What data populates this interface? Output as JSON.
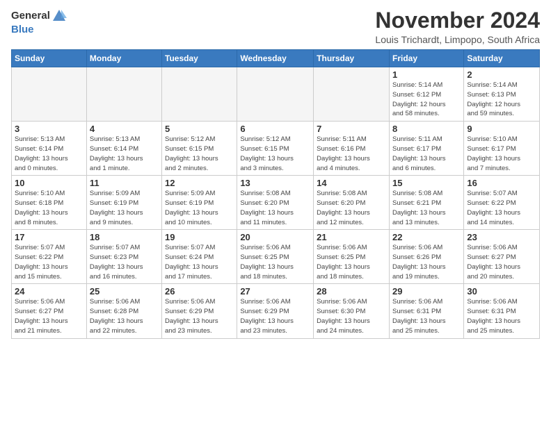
{
  "header": {
    "logo_general": "General",
    "logo_blue": "Blue",
    "title": "November 2024",
    "subtitle": "Louis Trichardt, Limpopo, South Africa"
  },
  "weekdays": [
    "Sunday",
    "Monday",
    "Tuesday",
    "Wednesday",
    "Thursday",
    "Friday",
    "Saturday"
  ],
  "weeks": [
    [
      {
        "day": "",
        "info": ""
      },
      {
        "day": "",
        "info": ""
      },
      {
        "day": "",
        "info": ""
      },
      {
        "day": "",
        "info": ""
      },
      {
        "day": "",
        "info": ""
      },
      {
        "day": "1",
        "info": "Sunrise: 5:14 AM\nSunset: 6:12 PM\nDaylight: 12 hours\nand 58 minutes."
      },
      {
        "day": "2",
        "info": "Sunrise: 5:14 AM\nSunset: 6:13 PM\nDaylight: 12 hours\nand 59 minutes."
      }
    ],
    [
      {
        "day": "3",
        "info": "Sunrise: 5:13 AM\nSunset: 6:14 PM\nDaylight: 13 hours\nand 0 minutes."
      },
      {
        "day": "4",
        "info": "Sunrise: 5:13 AM\nSunset: 6:14 PM\nDaylight: 13 hours\nand 1 minute."
      },
      {
        "day": "5",
        "info": "Sunrise: 5:12 AM\nSunset: 6:15 PM\nDaylight: 13 hours\nand 2 minutes."
      },
      {
        "day": "6",
        "info": "Sunrise: 5:12 AM\nSunset: 6:15 PM\nDaylight: 13 hours\nand 3 minutes."
      },
      {
        "day": "7",
        "info": "Sunrise: 5:11 AM\nSunset: 6:16 PM\nDaylight: 13 hours\nand 4 minutes."
      },
      {
        "day": "8",
        "info": "Sunrise: 5:11 AM\nSunset: 6:17 PM\nDaylight: 13 hours\nand 6 minutes."
      },
      {
        "day": "9",
        "info": "Sunrise: 5:10 AM\nSunset: 6:17 PM\nDaylight: 13 hours\nand 7 minutes."
      }
    ],
    [
      {
        "day": "10",
        "info": "Sunrise: 5:10 AM\nSunset: 6:18 PM\nDaylight: 13 hours\nand 8 minutes."
      },
      {
        "day": "11",
        "info": "Sunrise: 5:09 AM\nSunset: 6:19 PM\nDaylight: 13 hours\nand 9 minutes."
      },
      {
        "day": "12",
        "info": "Sunrise: 5:09 AM\nSunset: 6:19 PM\nDaylight: 13 hours\nand 10 minutes."
      },
      {
        "day": "13",
        "info": "Sunrise: 5:08 AM\nSunset: 6:20 PM\nDaylight: 13 hours\nand 11 minutes."
      },
      {
        "day": "14",
        "info": "Sunrise: 5:08 AM\nSunset: 6:20 PM\nDaylight: 13 hours\nand 12 minutes."
      },
      {
        "day": "15",
        "info": "Sunrise: 5:08 AM\nSunset: 6:21 PM\nDaylight: 13 hours\nand 13 minutes."
      },
      {
        "day": "16",
        "info": "Sunrise: 5:07 AM\nSunset: 6:22 PM\nDaylight: 13 hours\nand 14 minutes."
      }
    ],
    [
      {
        "day": "17",
        "info": "Sunrise: 5:07 AM\nSunset: 6:22 PM\nDaylight: 13 hours\nand 15 minutes."
      },
      {
        "day": "18",
        "info": "Sunrise: 5:07 AM\nSunset: 6:23 PM\nDaylight: 13 hours\nand 16 minutes."
      },
      {
        "day": "19",
        "info": "Sunrise: 5:07 AM\nSunset: 6:24 PM\nDaylight: 13 hours\nand 17 minutes."
      },
      {
        "day": "20",
        "info": "Sunrise: 5:06 AM\nSunset: 6:25 PM\nDaylight: 13 hours\nand 18 minutes."
      },
      {
        "day": "21",
        "info": "Sunrise: 5:06 AM\nSunset: 6:25 PM\nDaylight: 13 hours\nand 18 minutes."
      },
      {
        "day": "22",
        "info": "Sunrise: 5:06 AM\nSunset: 6:26 PM\nDaylight: 13 hours\nand 19 minutes."
      },
      {
        "day": "23",
        "info": "Sunrise: 5:06 AM\nSunset: 6:27 PM\nDaylight: 13 hours\nand 20 minutes."
      }
    ],
    [
      {
        "day": "24",
        "info": "Sunrise: 5:06 AM\nSunset: 6:27 PM\nDaylight: 13 hours\nand 21 minutes."
      },
      {
        "day": "25",
        "info": "Sunrise: 5:06 AM\nSunset: 6:28 PM\nDaylight: 13 hours\nand 22 minutes."
      },
      {
        "day": "26",
        "info": "Sunrise: 5:06 AM\nSunset: 6:29 PM\nDaylight: 13 hours\nand 23 minutes."
      },
      {
        "day": "27",
        "info": "Sunrise: 5:06 AM\nSunset: 6:29 PM\nDaylight: 13 hours\nand 23 minutes."
      },
      {
        "day": "28",
        "info": "Sunrise: 5:06 AM\nSunset: 6:30 PM\nDaylight: 13 hours\nand 24 minutes."
      },
      {
        "day": "29",
        "info": "Sunrise: 5:06 AM\nSunset: 6:31 PM\nDaylight: 13 hours\nand 25 minutes."
      },
      {
        "day": "30",
        "info": "Sunrise: 5:06 AM\nSunset: 6:31 PM\nDaylight: 13 hours\nand 25 minutes."
      }
    ]
  ]
}
